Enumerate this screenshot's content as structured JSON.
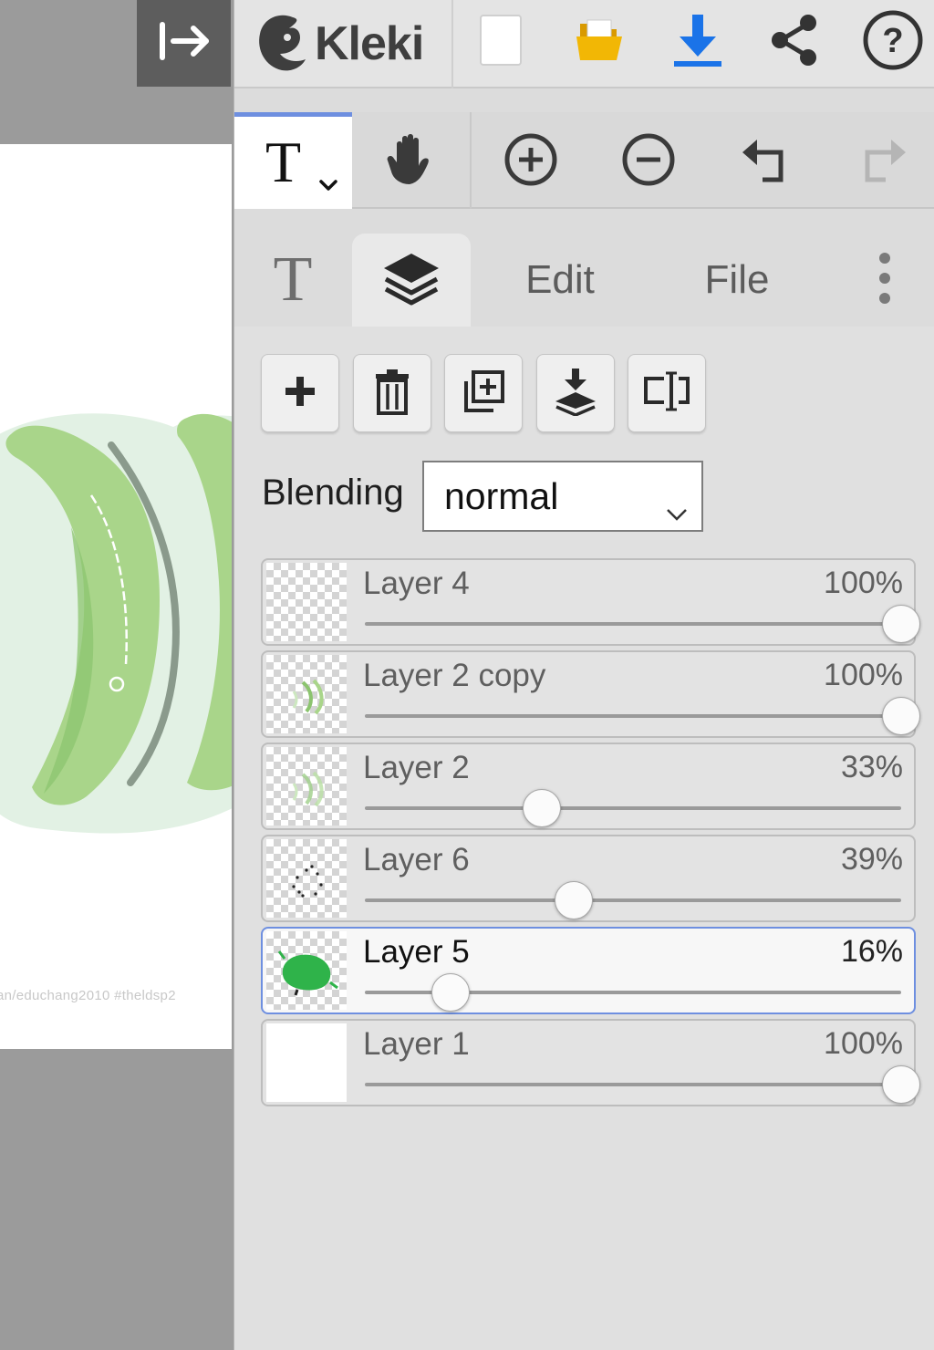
{
  "app": {
    "name": "Kleki"
  },
  "topbar": {
    "buttons": [
      {
        "icon": "new-image-icon"
      },
      {
        "icon": "open-folder-icon"
      },
      {
        "icon": "download-icon"
      },
      {
        "icon": "share-icon"
      },
      {
        "icon": "help-icon"
      }
    ]
  },
  "tools": {
    "active": "text",
    "text_glyph": "T",
    "buttons": [
      "text-tool",
      "hand-tool",
      "zoom-in",
      "zoom-out",
      "undo",
      "redo"
    ]
  },
  "tabs": {
    "brush_glyph": "T",
    "items": [
      {
        "id": "brush",
        "icon": "text-icon"
      },
      {
        "id": "layers",
        "icon": "layers-icon",
        "active": true
      },
      {
        "id": "edit",
        "label": "Edit"
      },
      {
        "id": "file",
        "label": "File"
      },
      {
        "id": "more",
        "icon": "more-vertical-icon"
      }
    ],
    "edit_label": "Edit",
    "file_label": "File"
  },
  "layer_actions": [
    "add-layer",
    "delete-layer",
    "duplicate-layer",
    "merge-down",
    "rename-layer"
  ],
  "blending": {
    "label": "Blending",
    "value": "normal"
  },
  "layers": [
    {
      "name": "Layer 4",
      "opacity_label": "100%",
      "opacity": 1.0,
      "thumb": "empty",
      "active": false
    },
    {
      "name": "Layer 2 copy",
      "opacity_label": "100%",
      "opacity": 1.0,
      "thumb": "strokes",
      "active": false
    },
    {
      "name": "Layer 2",
      "opacity_label": "33%",
      "opacity": 0.33,
      "thumb": "strokes-faint",
      "active": false
    },
    {
      "name": "Layer 6",
      "opacity_label": "39%",
      "opacity": 0.39,
      "thumb": "dots",
      "active": false
    },
    {
      "name": "Layer 5",
      "opacity_label": "16%",
      "opacity": 0.16,
      "thumb": "blob",
      "active": true
    },
    {
      "name": "Layer 1",
      "opacity_label": "100%",
      "opacity": 1.0,
      "thumb": "white",
      "active": false
    }
  ],
  "canvas": {
    "watermark": "an/educhang2010 #theldsp2"
  },
  "colors": {
    "accent_blue": "#1a73e8",
    "folder_yellow": "#f2b705",
    "active_outline": "#6e8fe0",
    "light_green": "#a9d58a",
    "mid_green": "#8cc46f",
    "pale_green": "#dff0df",
    "blob_green": "#2fb34a"
  }
}
